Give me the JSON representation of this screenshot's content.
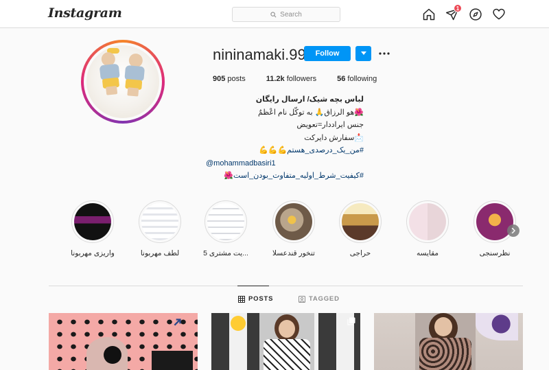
{
  "topbar": {
    "logo": "Instagram",
    "search_placeholder": "Search",
    "notification_count": "1",
    "icons": [
      "home-icon",
      "direct-icon",
      "explore-icon",
      "activity-icon"
    ]
  },
  "profile": {
    "username": "nininamaki.99",
    "follow_label": "Follow",
    "posts_count": "905",
    "posts_label": "posts",
    "followers_count": "11.2k",
    "followers_label": "followers",
    "following_count": "56",
    "following_label": "following",
    "bio_name": "لباس بچه شیک/ ارسال رایگان",
    "bio_lines": [
      "🌺هو الرزاق🙏 به توکّل نام اعْظمٌ",
      "جنس ایراددار=تعویض",
      "📩سفارش دایرکت",
      "#من_یک_درصدی_هستم💪💪💪",
      "@mohammadbasiri1",
      "#کیفیت_شرط_اولیه_متفاوت_بودن_است🌺"
    ]
  },
  "highlights": [
    {
      "label": "واریزی مهربونا"
    },
    {
      "label": "لطف مهربونا"
    },
    {
      "label": "...یت مشتری 5"
    },
    {
      "label": "تنخور قندعسلا"
    },
    {
      "label": "حراجی"
    },
    {
      "label": "مقایسه"
    },
    {
      "label": "نظرسنجی"
    }
  ],
  "tabs": {
    "posts": "POSTS",
    "tagged": "TAGGED"
  },
  "colors": {
    "accent": "#0095f6",
    "badge": "#ed4956",
    "text": "#262626",
    "muted": "#8e8e8e"
  }
}
